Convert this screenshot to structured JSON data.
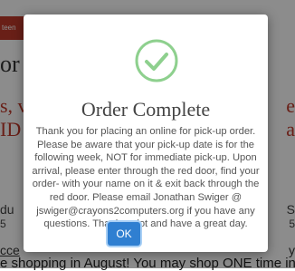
{
  "background": {
    "topbar_text": "teen",
    "left_heading": "or",
    "left_red_line1": "s, v",
    "left_red_line2": "ID",
    "right_red_line1": "e",
    "right_red_line2": "a",
    "left_small1": "du",
    "left_small2": "5",
    "right_small1": "S",
    "right_small2": "5",
    "link_text": "cce",
    "right_fragment": "y",
    "bottom_line": "e shopping in August! You may shop ONE time in A"
  },
  "modal": {
    "icon": "checkmark-circle-icon",
    "title": "Order Complete",
    "message": "Thank you for placing an online for pick-up order. Please be aware that your pick-up date is for the following week, NOT for immediate pick-up. Upon arrival, please enter through the red door, find your order- with your name on it & exit back through the red door. Please email Jonathan Swiger @ jswiger@crayons2computers.org if you have any questions. Thanks a lot and have a great day.",
    "ok_label": "OK"
  },
  "colors": {
    "success_green": "#8ed08e",
    "button_blue": "#2f7fd1",
    "brand_red": "#c0392b"
  }
}
